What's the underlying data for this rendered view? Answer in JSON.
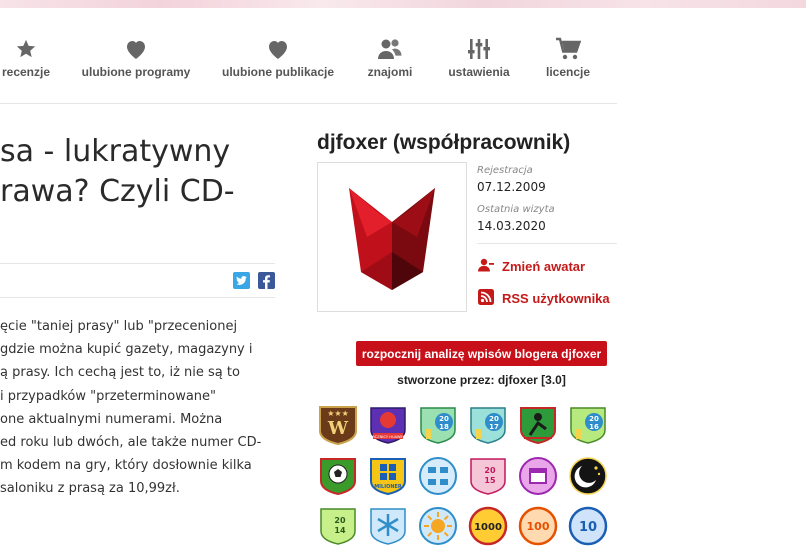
{
  "nav": {
    "items": [
      {
        "label": "recenzje",
        "icon": "star-icon"
      },
      {
        "label": "ulubione programy",
        "icon": "heart-icon"
      },
      {
        "label": "ulubione publikacje",
        "icon": "heart-icon"
      },
      {
        "label": "znajomi",
        "icon": "users-icon"
      },
      {
        "label": "ustawienia",
        "icon": "sliders-icon"
      },
      {
        "label": "licencje",
        "icon": "cart-icon"
      }
    ]
  },
  "article": {
    "title_lines": [
      "sa - lukratywny",
      "rawa? Czyli CD-"
    ],
    "body_lines": [
      "ęcie \"taniej prasy\" lub \"przecenionej",
      "gdzie można kupić gazety, magazyny i",
      "ą prasy. Ich cechą jest to, iż nie są to",
      "i przypadków \"przeterminowane\"",
      "one aktualnymi numerami. Można",
      "ed roku lub dwóch, ale także numer CD-",
      "m kodem na gry, który dosłownie kilka",
      "saloniku z prasą za 10,99zł."
    ]
  },
  "profile": {
    "name": "djfoxer (współpracownik)",
    "registration_label": "Rejestracja",
    "registration_date": "07.12.2009",
    "last_visit_label": "Ostatnia wizyta",
    "last_visit_date": "14.03.2020",
    "change_avatar_label": "Zmień awatar",
    "rss_label": "RSS użytkownika",
    "analyze_button_label": "rozpocznij analizę wpisów blogera djfoxer",
    "created_by_label": "stworzone przez: djfoxer [3.0]"
  },
  "badges": [
    {
      "icon": "w-shield-badge",
      "text": "W"
    },
    {
      "icon": "huawei-badge",
      "text": "ЯCZNICY HUAWEI"
    },
    {
      "icon": "year-2018-badge",
      "text": "2018"
    },
    {
      "icon": "year-2017-badge",
      "text": "2017"
    },
    {
      "icon": "skier-badge",
      "text": ""
    },
    {
      "icon": "year-2016-badge",
      "text": "2016"
    },
    {
      "icon": "football-badge",
      "text": ""
    },
    {
      "icon": "windows-badge",
      "text": "MILIONER"
    },
    {
      "icon": "network-badge",
      "text": ""
    },
    {
      "icon": "year-2015-badge",
      "text": "2015"
    },
    {
      "icon": "calendar-badge",
      "text": ""
    },
    {
      "icon": "night-moon-badge",
      "text": ""
    },
    {
      "icon": "year-2014-badge",
      "text": "2014"
    },
    {
      "icon": "snowflake-badge",
      "text": ""
    },
    {
      "icon": "sun-badge",
      "text": ""
    },
    {
      "icon": "count-1000-badge",
      "text": "1000"
    },
    {
      "icon": "count-100-badge",
      "text": "100"
    },
    {
      "icon": "count-10-badge",
      "text": "10"
    }
  ],
  "colors": {
    "accent_red": "#c8101a",
    "link_red": "#c41a1a",
    "nav_gray": "#555555"
  }
}
